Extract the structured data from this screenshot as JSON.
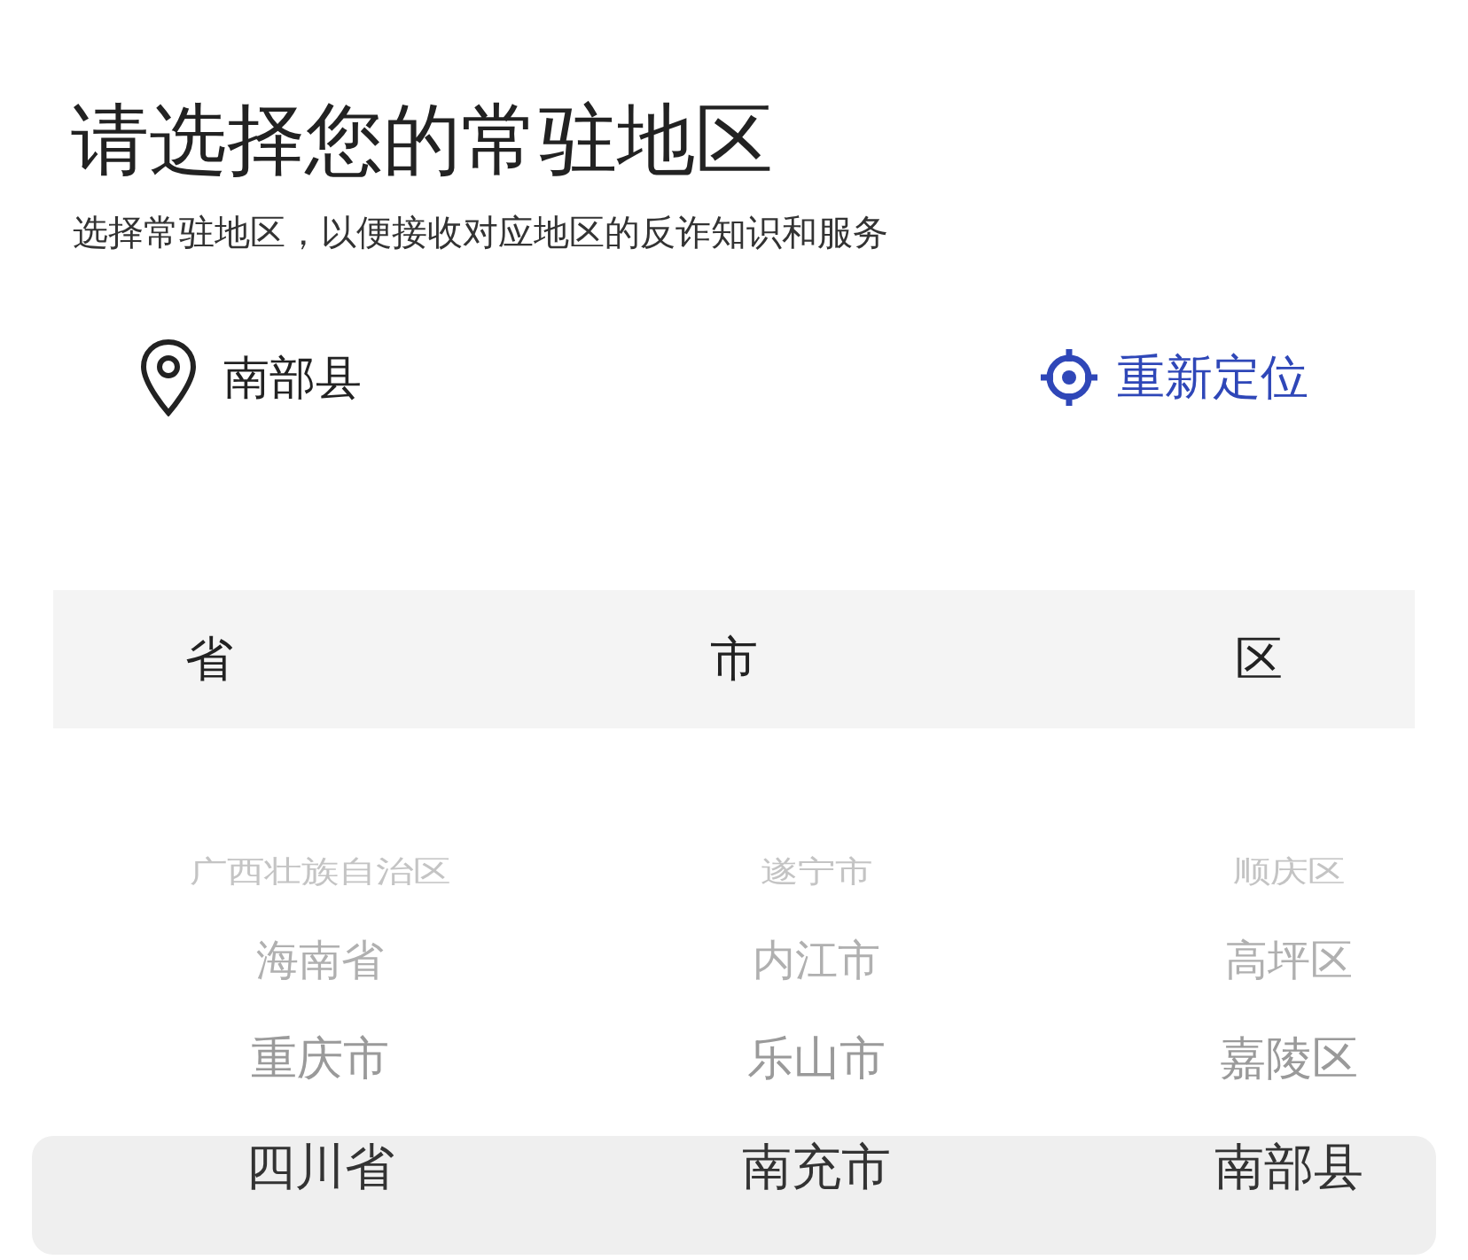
{
  "title": "请选择您的常驻地区",
  "subtitle": "选择常驻地区，以便接收对应地区的反诈知识和服务",
  "location": {
    "current": "南部县",
    "relocate": "重新定位"
  },
  "picker": {
    "columns": [
      {
        "header": "省",
        "items": [
          {
            "label": "广西壮族自治区",
            "selected": false
          },
          {
            "label": "海南省",
            "selected": false
          },
          {
            "label": "重庆市",
            "selected": false
          },
          {
            "label": "四川省",
            "selected": true
          }
        ]
      },
      {
        "header": "市",
        "items": [
          {
            "label": "遂宁市",
            "selected": false
          },
          {
            "label": "内江市",
            "selected": false
          },
          {
            "label": "乐山市",
            "selected": false
          },
          {
            "label": "南充市",
            "selected": true
          }
        ]
      },
      {
        "header": "区",
        "items": [
          {
            "label": "顺庆区",
            "selected": false
          },
          {
            "label": "高坪区",
            "selected": false
          },
          {
            "label": "嘉陵区",
            "selected": false
          },
          {
            "label": "南部县",
            "selected": true
          }
        ]
      }
    ]
  }
}
